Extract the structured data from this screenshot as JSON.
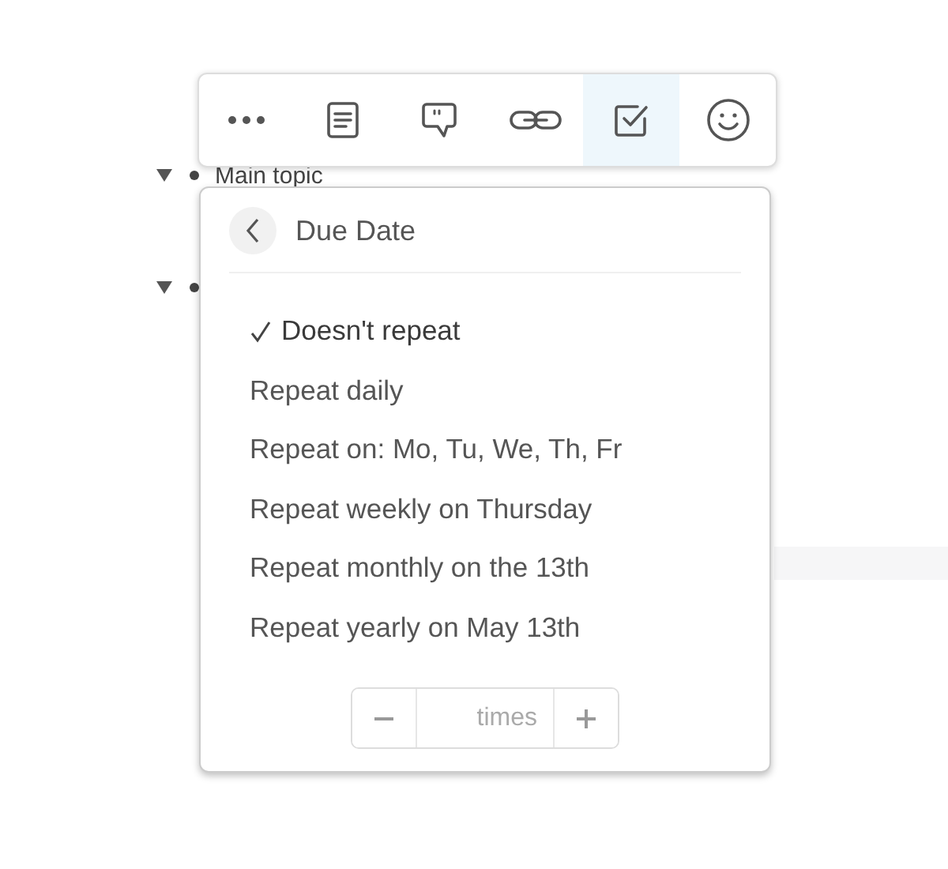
{
  "outline": {
    "rows": [
      {
        "label": "Main topic",
        "expanded": true
      },
      {
        "expanded": true
      }
    ]
  },
  "toolbar": {
    "buttons": [
      {
        "kind": "more",
        "selected": false
      },
      {
        "kind": "note",
        "selected": false
      },
      {
        "kind": "comment",
        "selected": false
      },
      {
        "kind": "link",
        "selected": false
      },
      {
        "kind": "task",
        "selected": true
      },
      {
        "kind": "emoji",
        "selected": false
      }
    ]
  },
  "panel": {
    "title": "Due Date",
    "options": [
      {
        "label": "Doesn't repeat",
        "selected": true
      },
      {
        "label": "Repeat daily",
        "selected": false
      },
      {
        "label": "Repeat on: Mo, Tu, We, Th, Fr",
        "selected": false
      },
      {
        "label": "Repeat weekly on Thursday",
        "selected": false
      },
      {
        "label": "Repeat monthly on the 13th",
        "selected": false
      },
      {
        "label": "Repeat yearly on May 13th",
        "selected": false
      }
    ],
    "stepper": {
      "placeholder": "times"
    }
  }
}
